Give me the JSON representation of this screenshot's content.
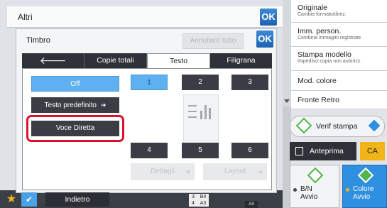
{
  "header": {
    "title": "Altri",
    "ok_label": "OK"
  },
  "dialog": {
    "title": "Timbro",
    "ok_label": "OK",
    "reset_label": "Annullare tutto",
    "tabs": [
      {
        "label": "🡐"
      },
      {
        "label": "Copie totali"
      },
      {
        "label": "Testo"
      },
      {
        "label": "Filigrana"
      }
    ],
    "buttons": {
      "off": "Off",
      "predefined": "Testo predefinito",
      "direct": "Voce Diretta"
    },
    "positions": [
      "1",
      "2",
      "3",
      "4",
      "5",
      "6"
    ],
    "selected_position": "1",
    "details_label": "Dettagli",
    "layout_label": "Layout"
  },
  "sidebar": {
    "items": [
      {
        "title": "Originale",
        "subtitle": "Cambia formato/direz."
      },
      {
        "title": "Imm. person.",
        "subtitle": "Combina immagini registrate"
      },
      {
        "title": "Stampa modello",
        "subtitle": "Impedisci copia non autorizz."
      },
      {
        "title": "Mod. colore",
        "subtitle": ""
      },
      {
        "title": "Fronte Retro",
        "subtitle": ""
      }
    ],
    "verify_label": "Verif stampa",
    "preview_label": "Anteprima",
    "ca_label": "CA",
    "bn_label": "B/N",
    "bn_sub": "Avvio",
    "color_label": "Colore",
    "color_sub": "Avvio"
  },
  "bottom": {
    "back_label": "Indietro",
    "tray_rows": [
      {
        "num": "3",
        "size": "B4"
      },
      {
        "num": "4",
        "size": "A3"
      }
    ],
    "paper_badge": "A4"
  },
  "colors": {
    "accent_blue": "#2f8fe0",
    "highlight_red": "#e0102a",
    "start_green": "#53b34d",
    "ca_yellow": "#f1b51a"
  }
}
